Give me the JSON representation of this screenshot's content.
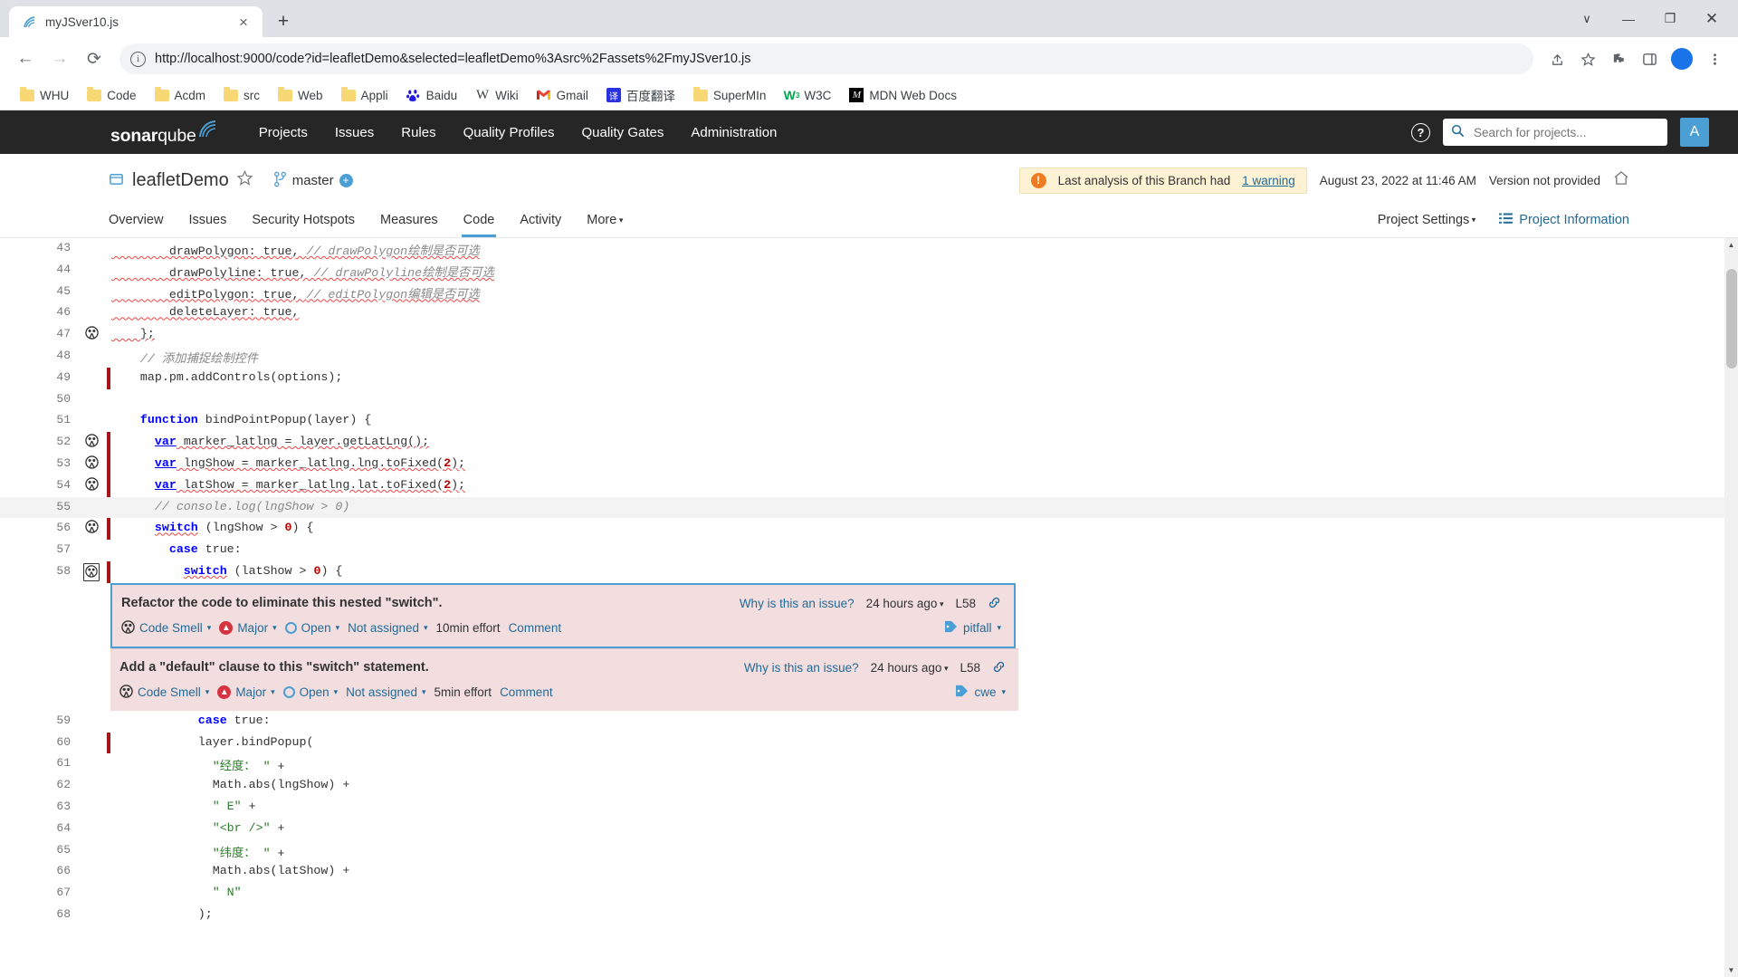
{
  "browser": {
    "tab": {
      "title": "myJSver10.js",
      "favicon": "sonarqube-icon",
      "close_label": "×"
    },
    "new_tab_label": "+",
    "window_controls": {
      "minimize": "—",
      "maximize": "❐",
      "close": "✕",
      "chevron": "∨"
    },
    "nav": {
      "back": "←",
      "forward": "→",
      "reload": "⟳"
    },
    "omnibox": {
      "url": "http://localhost:9000/code?id=leafletDemo&selected=leafletDemo%3Asrc%2Fassets%2FmyJSver10.js",
      "info_icon": "info-icon",
      "share_icon": "share-icon",
      "star_icon": "star-icon",
      "extensions_icon": "puzzle-icon",
      "sidepanel_icon": "sidepanel-icon",
      "profile_letter": "",
      "menu_icon": "kebab-menu-icon"
    },
    "bookmarks": [
      {
        "label": "WHU",
        "icon": "folder-icon"
      },
      {
        "label": "Code",
        "icon": "folder-icon"
      },
      {
        "label": "Acdm",
        "icon": "folder-icon"
      },
      {
        "label": "src",
        "icon": "folder-icon"
      },
      {
        "label": "Web",
        "icon": "folder-icon"
      },
      {
        "label": "Appli",
        "icon": "folder-icon"
      },
      {
        "label": "Baidu",
        "icon": "baidu-icon"
      },
      {
        "label": "Wiki",
        "icon": "wikipedia-icon"
      },
      {
        "label": "Gmail",
        "icon": "gmail-icon"
      },
      {
        "label": "百度翻译",
        "icon": "fanyi-icon"
      },
      {
        "label": "SuperMIn",
        "icon": "folder-icon"
      },
      {
        "label": "W3C",
        "icon": "w3c-icon"
      },
      {
        "label": "MDN Web Docs",
        "icon": "mdn-icon"
      }
    ]
  },
  "sonarqube": {
    "logo": {
      "bold": "sonar",
      "light": "qube"
    },
    "nav_links": [
      "Projects",
      "Issues",
      "Rules",
      "Quality Profiles",
      "Quality Gates",
      "Administration"
    ],
    "help_icon": "help-icon",
    "search": {
      "placeholder": "Search for projects...",
      "icon": "search-icon"
    },
    "avatar_letter": "A"
  },
  "project": {
    "icon": "project-icon",
    "name": "leafletDemo",
    "favorite_icon": "star-outline-icon",
    "branch_icon": "branch-icon",
    "branch": "master",
    "branch_add_icon": "plus-circle-icon",
    "warning": {
      "icon": "warning-icon",
      "text_before": "Last analysis of this Branch had",
      "link": "1 warning"
    },
    "analysis_date": "August 23, 2022 at 11:46 AM",
    "version": "Version not provided",
    "home_icon": "home-icon",
    "tabs": [
      {
        "label": "Overview",
        "active": false
      },
      {
        "label": "Issues",
        "active": false
      },
      {
        "label": "Security Hotspots",
        "active": false
      },
      {
        "label": "Measures",
        "active": false
      },
      {
        "label": "Code",
        "active": true
      },
      {
        "label": "Activity",
        "active": false
      },
      {
        "label": "More",
        "active": false
      }
    ],
    "settings_label": "Project Settings",
    "information_label": "Project Information",
    "information_icon": "list-icon"
  },
  "code": {
    "lines": [
      {
        "n": "43",
        "gutter": "",
        "bar": false,
        "hl": false,
        "tokens": [
          {
            "t": "        drawPolygon: true, ",
            "c": "plain",
            "u": true
          },
          {
            "t": "// drawPolygon绘制是否可选",
            "c": "cm",
            "u": true
          }
        ]
      },
      {
        "n": "44",
        "gutter": "",
        "bar": false,
        "hl": false,
        "tokens": [
          {
            "t": "        drawPolyline: true, ",
            "c": "plain",
            "u": true
          },
          {
            "t": "// drawPolyline绘制是否可选",
            "c": "cm",
            "u": true
          }
        ]
      },
      {
        "n": "45",
        "gutter": "",
        "bar": false,
        "hl": false,
        "tokens": [
          {
            "t": "        editPolygon: true, ",
            "c": "plain",
            "u": true
          },
          {
            "t": "// editPolygon编辑是否可选",
            "c": "cm",
            "u": true
          }
        ]
      },
      {
        "n": "46",
        "gutter": "",
        "bar": false,
        "hl": false,
        "tokens": [
          {
            "t": "        deleteLayer: true,",
            "c": "plain",
            "u": true
          }
        ]
      },
      {
        "n": "47",
        "gutter": "smell",
        "bar": false,
        "hl": false,
        "tokens": [
          {
            "t": "    };",
            "c": "plain",
            "u": true
          }
        ]
      },
      {
        "n": "48",
        "gutter": "",
        "bar": false,
        "hl": false,
        "tokens": [
          {
            "t": "    // 添加捕捉绘制控件",
            "c": "cm",
            "u": false
          }
        ]
      },
      {
        "n": "49",
        "gutter": "",
        "bar": true,
        "hl": false,
        "tokens": [
          {
            "t": "    map.pm.addControls(options);",
            "c": "plain",
            "u": false
          }
        ]
      },
      {
        "n": "50",
        "gutter": "",
        "bar": false,
        "hl": false,
        "tokens": [
          {
            "t": "",
            "c": "plain",
            "u": false
          }
        ]
      },
      {
        "n": "51",
        "gutter": "",
        "bar": false,
        "hl": false,
        "tokens": [
          {
            "t": "    ",
            "c": "plain",
            "u": false
          },
          {
            "t": "function",
            "c": "kw",
            "u": false
          },
          {
            "t": " bindPointPopup(layer) {",
            "c": "plain",
            "u": false
          }
        ]
      },
      {
        "n": "52",
        "gutter": "smell",
        "bar": true,
        "hl": false,
        "tokens": [
          {
            "t": "      ",
            "c": "plain",
            "u": false
          },
          {
            "t": "var",
            "c": "kwu",
            "u": false
          },
          {
            "t": " marker_latlng = layer.getLatLng();",
            "c": "plain",
            "u": true
          }
        ]
      },
      {
        "n": "53",
        "gutter": "smell",
        "bar": true,
        "hl": false,
        "tokens": [
          {
            "t": "      ",
            "c": "plain",
            "u": false
          },
          {
            "t": "var",
            "c": "kwu",
            "u": false
          },
          {
            "t": " lngShow = marker_latlng.lng.toFixed(",
            "c": "plain",
            "u": true
          },
          {
            "t": "2",
            "c": "num",
            "u": true
          },
          {
            "t": ");",
            "c": "plain",
            "u": true
          }
        ]
      },
      {
        "n": "54",
        "gutter": "smell",
        "bar": true,
        "hl": false,
        "tokens": [
          {
            "t": "      ",
            "c": "plain",
            "u": false
          },
          {
            "t": "var",
            "c": "kwu",
            "u": false
          },
          {
            "t": " latShow = marker_latlng.lat.toFixed(",
            "c": "plain",
            "u": true
          },
          {
            "t": "2",
            "c": "num",
            "u": true
          },
          {
            "t": ");",
            "c": "plain",
            "u": true
          }
        ]
      },
      {
        "n": "55",
        "gutter": "",
        "bar": false,
        "hl": true,
        "tokens": [
          {
            "t": "      // console.log(lngShow > 0)",
            "c": "cm",
            "u": false
          }
        ]
      },
      {
        "n": "56",
        "gutter": "smell",
        "bar": true,
        "hl": false,
        "tokens": [
          {
            "t": "      ",
            "c": "plain",
            "u": false
          },
          {
            "t": "switch",
            "c": "kwu",
            "u": true
          },
          {
            "t": " (lngShow > ",
            "c": "plain",
            "u": false
          },
          {
            "t": "0",
            "c": "num",
            "u": false
          },
          {
            "t": ") {",
            "c": "plain",
            "u": false
          }
        ]
      },
      {
        "n": "57",
        "gutter": "",
        "bar": false,
        "hl": false,
        "tokens": [
          {
            "t": "        ",
            "c": "plain",
            "u": false
          },
          {
            "t": "case",
            "c": "kw",
            "u": false
          },
          {
            "t": " true:",
            "c": "plain",
            "u": false
          }
        ]
      },
      {
        "n": "58",
        "gutter": "smell-box",
        "bar": true,
        "hl": false,
        "tokens": [
          {
            "t": "          ",
            "c": "plain",
            "u": false
          },
          {
            "t": "switch",
            "c": "kwu",
            "u": true
          },
          {
            "t": " (latShow > ",
            "c": "plain",
            "u": false
          },
          {
            "t": "0",
            "c": "num",
            "u": false
          },
          {
            "t": ") {",
            "c": "plain",
            "u": false
          }
        ]
      }
    ],
    "lines_after": [
      {
        "n": "59",
        "gutter": "",
        "bar": false,
        "hl": false,
        "tokens": [
          {
            "t": "            ",
            "c": "plain",
            "u": false
          },
          {
            "t": "case",
            "c": "kw",
            "u": false
          },
          {
            "t": " true:",
            "c": "plain",
            "u": false
          }
        ]
      },
      {
        "n": "60",
        "gutter": "",
        "bar": true,
        "hl": false,
        "tokens": [
          {
            "t": "            layer.bindPopup(",
            "c": "plain",
            "u": false
          }
        ]
      },
      {
        "n": "61",
        "gutter": "",
        "bar": false,
        "hl": false,
        "tokens": [
          {
            "t": "              ",
            "c": "plain",
            "u": false
          },
          {
            "t": "\"经度： \"",
            "c": "str",
            "u": false
          },
          {
            "t": " +",
            "c": "plain",
            "u": false
          }
        ]
      },
      {
        "n": "62",
        "gutter": "",
        "bar": false,
        "hl": false,
        "tokens": [
          {
            "t": "              Math.abs(lngShow) +",
            "c": "plain",
            "u": false
          }
        ]
      },
      {
        "n": "63",
        "gutter": "",
        "bar": false,
        "hl": false,
        "tokens": [
          {
            "t": "              ",
            "c": "plain",
            "u": false
          },
          {
            "t": "\" E\"",
            "c": "str",
            "u": false
          },
          {
            "t": " +",
            "c": "plain",
            "u": false
          }
        ]
      },
      {
        "n": "64",
        "gutter": "",
        "bar": false,
        "hl": false,
        "tokens": [
          {
            "t": "              ",
            "c": "plain",
            "u": false
          },
          {
            "t": "\"<br />\"",
            "c": "str",
            "u": false
          },
          {
            "t": " +",
            "c": "plain",
            "u": false
          }
        ]
      },
      {
        "n": "65",
        "gutter": "",
        "bar": false,
        "hl": false,
        "tokens": [
          {
            "t": "              ",
            "c": "plain",
            "u": false
          },
          {
            "t": "\"纬度： \"",
            "c": "str",
            "u": false
          },
          {
            "t": " +",
            "c": "plain",
            "u": false
          }
        ]
      },
      {
        "n": "66",
        "gutter": "",
        "bar": false,
        "hl": false,
        "tokens": [
          {
            "t": "              Math.abs(latShow) +",
            "c": "plain",
            "u": false
          }
        ]
      },
      {
        "n": "67",
        "gutter": "",
        "bar": false,
        "hl": false,
        "tokens": [
          {
            "t": "              ",
            "c": "plain",
            "u": false
          },
          {
            "t": "\" N\"",
            "c": "str",
            "u": false
          }
        ]
      },
      {
        "n": "68",
        "gutter": "",
        "bar": false,
        "hl": false,
        "tokens": [
          {
            "t": "            );",
            "c": "plain",
            "u": false
          }
        ]
      }
    ]
  },
  "issues": [
    {
      "selected": true,
      "title": "Refactor the code to eliminate this nested \"switch\".",
      "why_label": "Why is this an issue?",
      "age": "24 hours ago",
      "age_caret": "▾",
      "line_ref": "L58",
      "link_icon": "permalink-icon",
      "type": "Code Smell",
      "type_icon": "code-smell-icon",
      "severity": "Major",
      "severity_icon": "major-severity-icon",
      "status": "Open",
      "status_icon": "open-status-icon",
      "assignee": "Not assigned",
      "effort": "10min effort",
      "comment_label": "Comment",
      "tag": "pitfall",
      "tag_icon": "tag-icon"
    },
    {
      "selected": false,
      "title": "Add a \"default\" clause to this \"switch\" statement.",
      "why_label": "Why is this an issue?",
      "age": "24 hours ago",
      "age_caret": "▾",
      "line_ref": "L58",
      "link_icon": "permalink-icon",
      "type": "Code Smell",
      "type_icon": "code-smell-icon",
      "severity": "Major",
      "severity_icon": "major-severity-icon",
      "status": "Open",
      "status_icon": "open-status-icon",
      "assignee": "Not assigned",
      "effort": "5min effort",
      "comment_label": "Comment",
      "tag": "cwe",
      "tag_icon": "tag-icon"
    }
  ]
}
